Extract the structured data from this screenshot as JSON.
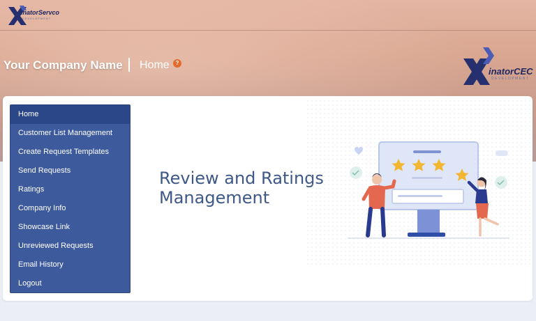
{
  "header": {
    "logo_text": "inatorServco",
    "logo_subtext": "DEVELOPMENT",
    "company_name": "Your Company Name",
    "breadcrumb": "Home",
    "help_glyph": "?",
    "right_logo_text": "inatorCEC",
    "right_logo_subtext": "DEVELOPMENT"
  },
  "sidebar": {
    "items": [
      {
        "label": "Home",
        "active": true
      },
      {
        "label": "Customer List Management"
      },
      {
        "label": "Create Request Templates"
      },
      {
        "label": "Send Requests"
      },
      {
        "label": "Ratings"
      },
      {
        "label": "Company Info"
      },
      {
        "label": "Showcase Link"
      },
      {
        "label": "Unreviewed Requests"
      },
      {
        "label": "Email History"
      },
      {
        "label": "Logout"
      }
    ]
  },
  "main": {
    "title_line1": "Review and Ratings",
    "title_line2": "Management"
  },
  "colors": {
    "sidebar_bg": "#3d5a9c",
    "sidebar_active": "#2c4787",
    "title": "#3e5888",
    "star": "#f2b632",
    "help_badge": "#e46a2c"
  },
  "icons": {
    "help": "question-icon",
    "illustration": "review-stars-illustration"
  }
}
